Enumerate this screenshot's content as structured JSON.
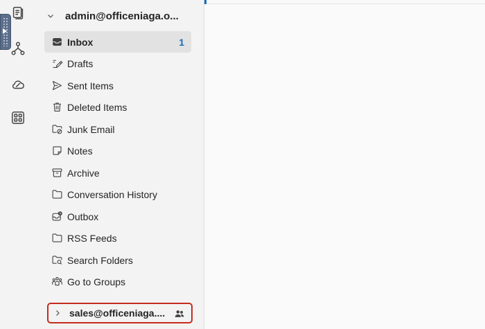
{
  "accounts": [
    {
      "email": "admin@officeniaga.o...",
      "expanded": true
    },
    {
      "email": "sales@officeniaga....",
      "expanded": false,
      "icon": "people-icon"
    }
  ],
  "folders": [
    {
      "label": "Inbox",
      "count": "1",
      "icon": "inbox-icon",
      "selected": true
    },
    {
      "label": "Drafts",
      "icon": "drafts-icon"
    },
    {
      "label": "Sent Items",
      "icon": "sent-icon"
    },
    {
      "label": "Deleted Items",
      "icon": "trash-icon"
    },
    {
      "label": "Junk Email",
      "icon": "junk-folder-icon"
    },
    {
      "label": "Notes",
      "icon": "note-icon"
    },
    {
      "label": "Archive",
      "icon": "archive-icon"
    },
    {
      "label": "Conversation History",
      "icon": "folder-icon"
    },
    {
      "label": "Outbox",
      "icon": "outbox-icon"
    },
    {
      "label": "RSS Feeds",
      "icon": "folder-icon"
    },
    {
      "label": "Search Folders",
      "icon": "search-folder-icon"
    },
    {
      "label": "Go to Groups",
      "icon": "groups-icon"
    }
  ],
  "rail": [
    "notes-app-icon",
    "org-chart-icon",
    "cloud-icon",
    "apps-icon"
  ],
  "colors": {
    "accent": "#0f6cbd",
    "highlight_border": "#c42b1c",
    "selected_bg": "#e2e2e2"
  }
}
